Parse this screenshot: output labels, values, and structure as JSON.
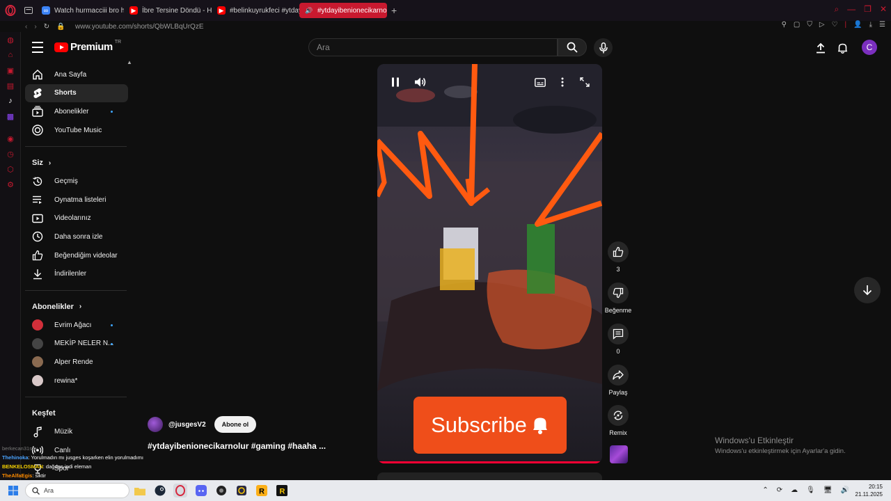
{
  "browser": {
    "tabs": [
      {
        "title": "Watch hurmacciii bro hurr",
        "active": false
      },
      {
        "title": "İbre Tersine Döndü - Hurr",
        "active": false
      },
      {
        "title": "#belinkuyrukfeci #ytdayib",
        "active": false
      },
      {
        "title": "#ytdayibenionecikarno",
        "active": true
      }
    ],
    "url": "www.youtube.com/shorts/QbWLBqUrQzE",
    "new_tab": "+"
  },
  "header": {
    "brand": "Premium",
    "country": "TR",
    "search_placeholder": "Ara",
    "avatar_letter": "C"
  },
  "sidebar": {
    "main": [
      {
        "label": "Ana Sayfa",
        "icon": "home-icon"
      },
      {
        "label": "Shorts",
        "icon": "shorts-icon",
        "active": true
      },
      {
        "label": "Abonelikler",
        "icon": "subscriptions-icon",
        "dot": true
      },
      {
        "label": "YouTube Music",
        "icon": "music-disc-icon"
      }
    ],
    "you_title": "Siz",
    "you": [
      {
        "label": "Geçmiş",
        "icon": "history-icon"
      },
      {
        "label": "Oynatma listeleri",
        "icon": "playlists-icon"
      },
      {
        "label": "Videolarınız",
        "icon": "your-videos-icon"
      },
      {
        "label": "Daha sonra izle",
        "icon": "watch-later-icon"
      },
      {
        "label": "Beğendiğim videolar",
        "icon": "liked-icon"
      },
      {
        "label": "İndirilenler",
        "icon": "download-icon"
      }
    ],
    "subs_title": "Abonelikler",
    "subs": [
      {
        "label": "Evrim Ağacı",
        "color": "#d12f3a",
        "dot": true
      },
      {
        "label": "MEKİP NELER N...",
        "color": "#444444",
        "dot": true
      },
      {
        "label": "Alper Rende",
        "color": "#8a6a50",
        "dot": false
      },
      {
        "label": "rewina*",
        "color": "#d8c8c8",
        "dot": false
      }
    ],
    "explore_title": "Keşfet",
    "explore": [
      {
        "label": "Müzik",
        "icon": "music-note-icon"
      },
      {
        "label": "Canlı",
        "icon": "live-icon"
      },
      {
        "label": "Spor",
        "icon": "trophy-icon"
      }
    ]
  },
  "video": {
    "overlay_text": "Subscribe",
    "channel": "@jusgesV2",
    "subscribe_label": "Abone ol",
    "title": "#ytdayibenionecikarnolur  #gaming #haaha ..."
  },
  "actions": {
    "likes": "3",
    "dislike": "Beğenme",
    "comments": "0",
    "share": "Paylaş",
    "remix": "Remix"
  },
  "windows_activation": {
    "title": "Windows'u Etkinleştir",
    "subtitle": "Windows'u etkinleştirmek için Ayarlar'a gidin."
  },
  "chat": [
    {
      "name": "Thehinoka",
      "text": ": Yorulmadın mı jusges koşarken elin yorulmadımı",
      "color": "#4aa3ff"
    },
    {
      "name": "BENKELOSMAN",
      "text": ": dağdan indi eleman",
      "color": "#f5d000"
    },
    {
      "name": "TheAlfaEgis",
      "text": ": siktir",
      "color": "#ff8c00"
    }
  ],
  "chat_faint": "berkecan31say",
  "taskbar": {
    "search_label": "Ara",
    "time": "20:15",
    "date": "21.11.2025"
  }
}
